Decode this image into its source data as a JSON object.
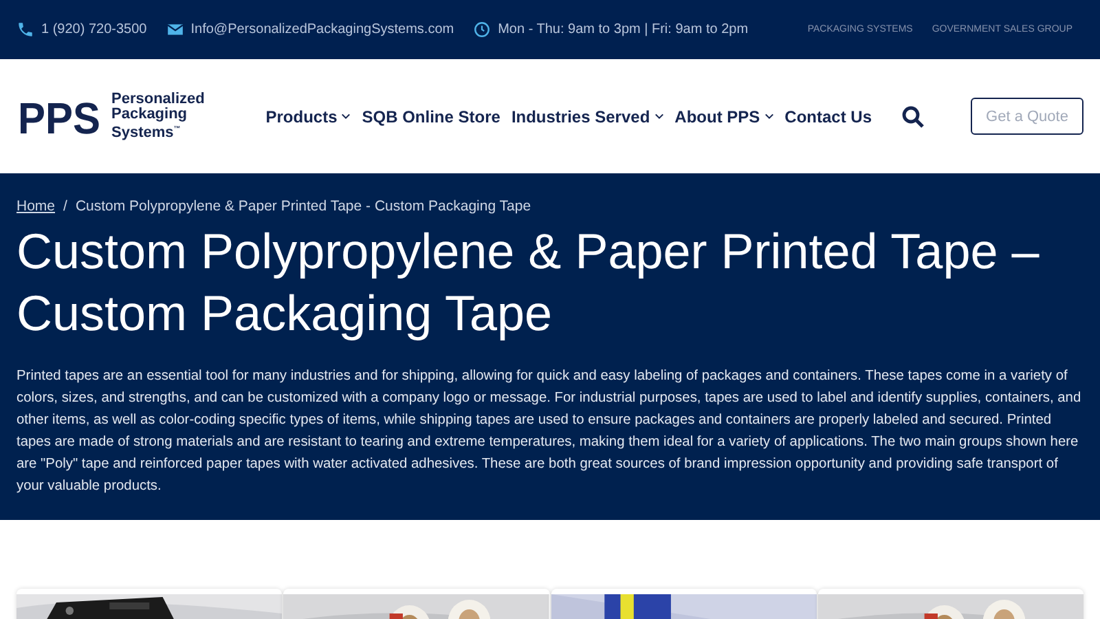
{
  "top_bar": {
    "phone": "1 (920) 720-3500",
    "email": "Info@PersonalizedPackagingSystems.com",
    "hours": "Mon - Thu: 9am to 3pm | Fri: 9am to 2pm",
    "links": [
      "PACKAGING SYSTEMS",
      "GOVERNMENT SALES GROUP"
    ]
  },
  "header": {
    "logo": {
      "mark": "PPS",
      "name": "Personalized Packaging Systems",
      "tm": "™"
    },
    "nav": [
      {
        "label": "Products",
        "dropdown": true
      },
      {
        "label": "SQB Online Store",
        "dropdown": false
      },
      {
        "label": "Industries Served",
        "dropdown": true
      },
      {
        "label": "About PPS",
        "dropdown": true
      },
      {
        "label": "Contact Us",
        "dropdown": false
      }
    ],
    "cta": "Get a Quote"
  },
  "hero": {
    "breadcrumb": [
      "Home",
      "Custom Polypropylene & Paper Printed Tape - Custom Packaging Tape"
    ],
    "separator": "/",
    "title": "Custom Polypropylene & Paper Printed Tape – Custom Packaging Tape",
    "text": "Printed tapes are an essential tool for many industries and for shipping, allowing for quick and easy labeling of packages and containers. These tapes come in a variety of colors, sizes, and strengths, and can be customized with a company logo or message. For industrial purposes, tapes are used to label and identify supplies, containers, and other items, as well as color-coding specific types of items, while shipping tapes are used to ensure packages and containers are properly labeled and secured. Printed tapes are made of strong materials and are resistant to tearing and extreme temperatures, making them ideal for a variety of applications. The two main groups shown here are \"Poly\" tape and reinforced paper tapes with water activated adhesives. These are both great sources of brand impression opportunity and providing safe transport of your valuable products."
  }
}
